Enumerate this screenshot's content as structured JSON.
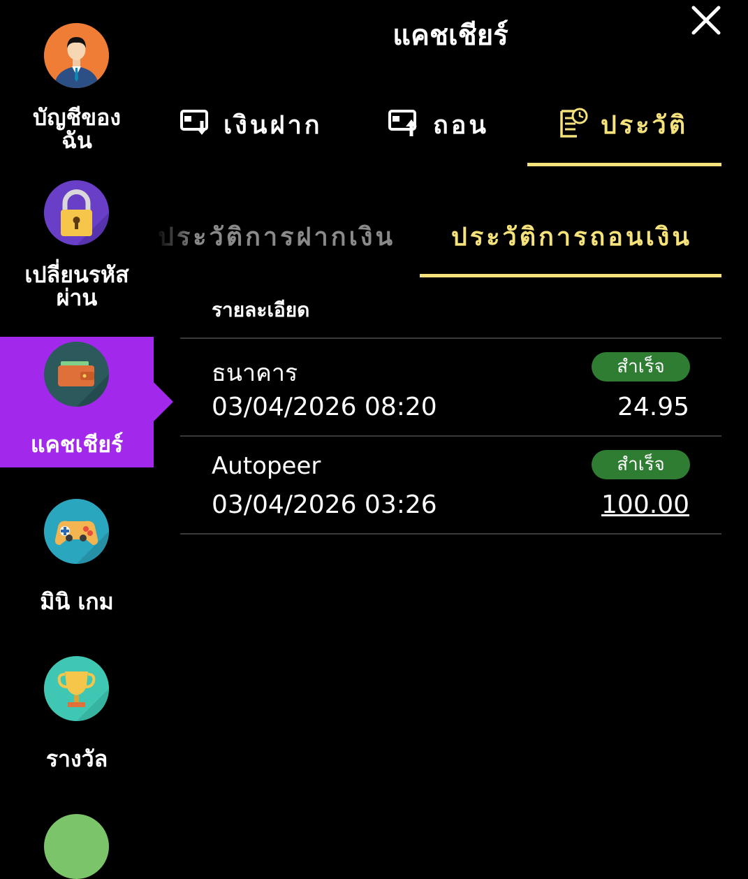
{
  "header": {
    "title": "แคชเชียร์",
    "close_icon": "close-icon"
  },
  "sidebar": {
    "items": [
      {
        "label": "บัญชีของ\nฉัน",
        "icon": "user-avatar-icon",
        "color": "#ef7d35"
      },
      {
        "label": "เปลี่ยนรหัส\nผ่าน",
        "icon": "padlock-icon",
        "color": "#6a3fc8"
      },
      {
        "label": "แคชเชียร์",
        "icon": "wallet-icon",
        "color": "#2c5a5c"
      },
      {
        "label": "มินิ เกม",
        "icon": "gamepad-icon",
        "color": "#2ba6bf"
      },
      {
        "label": "รางวัล",
        "icon": "trophy-icon",
        "color": "#3fc7b3"
      }
    ],
    "active_color": "#a228ec"
  },
  "tabs": [
    {
      "label": "เงินฝาก",
      "icon": "deposit-icon"
    },
    {
      "label": "ถอน",
      "icon": "withdraw-icon"
    },
    {
      "label": "ประวัติ",
      "icon": "history-icon"
    }
  ],
  "subtabs": [
    {
      "label": "ประวัติการฝากเงิน"
    },
    {
      "label": "ประวัติการถอนเงิน"
    }
  ],
  "table": {
    "column_header": "รายละเอียด",
    "rows": [
      {
        "name": "ธนาคาร",
        "status": "สำเร็จ",
        "datetime": "03/04/2026 08:20",
        "amount": "24.95"
      },
      {
        "name": "Autopeer",
        "status": "สำเร็จ",
        "datetime": "03/04/2026 03:26",
        "amount": "100.00"
      }
    ]
  },
  "colors": {
    "accent": "#f5e27a",
    "success": "#2f7d32",
    "background": "#000000"
  }
}
